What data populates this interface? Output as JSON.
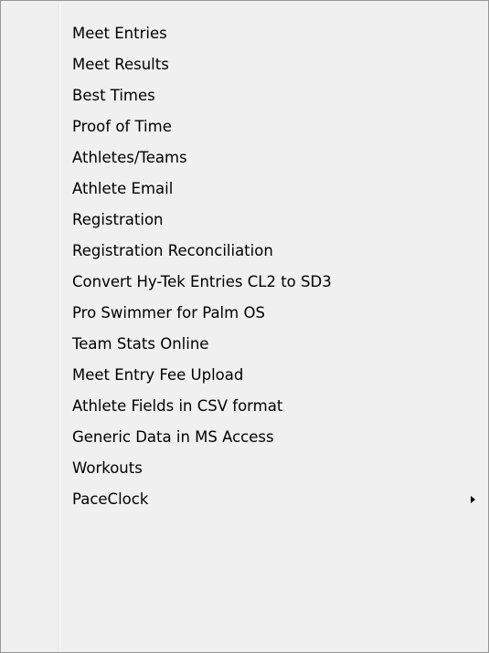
{
  "menu": {
    "items": [
      {
        "label": "Meet Entries",
        "has_submenu": false
      },
      {
        "label": "Meet Results",
        "has_submenu": false
      },
      {
        "label": "Best Times",
        "has_submenu": false
      },
      {
        "label": "Proof of Time",
        "has_submenu": false
      },
      {
        "label": "Athletes/Teams",
        "has_submenu": false
      },
      {
        "label": "Athlete Email",
        "has_submenu": false
      },
      {
        "label": "Registration",
        "has_submenu": false
      },
      {
        "label": "Registration Reconciliation",
        "has_submenu": false
      },
      {
        "label": "Convert Hy-Tek Entries CL2 to SD3",
        "has_submenu": false
      },
      {
        "label": "Pro Swimmer for Palm OS",
        "has_submenu": false
      },
      {
        "label": "Team Stats Online",
        "has_submenu": false
      },
      {
        "label": "Meet Entry Fee Upload",
        "has_submenu": false
      },
      {
        "label": "Athlete Fields in CSV format",
        "has_submenu": false
      },
      {
        "label": "Generic Data in MS Access",
        "has_submenu": false
      },
      {
        "label": "Workouts",
        "has_submenu": false
      },
      {
        "label": "PaceClock",
        "has_submenu": true,
        "submenu_icon": "chevron-right-icon"
      }
    ]
  },
  "colors": {
    "menu_background": "#f0f0f0",
    "menu_border": "#979797",
    "text": "#000000"
  }
}
